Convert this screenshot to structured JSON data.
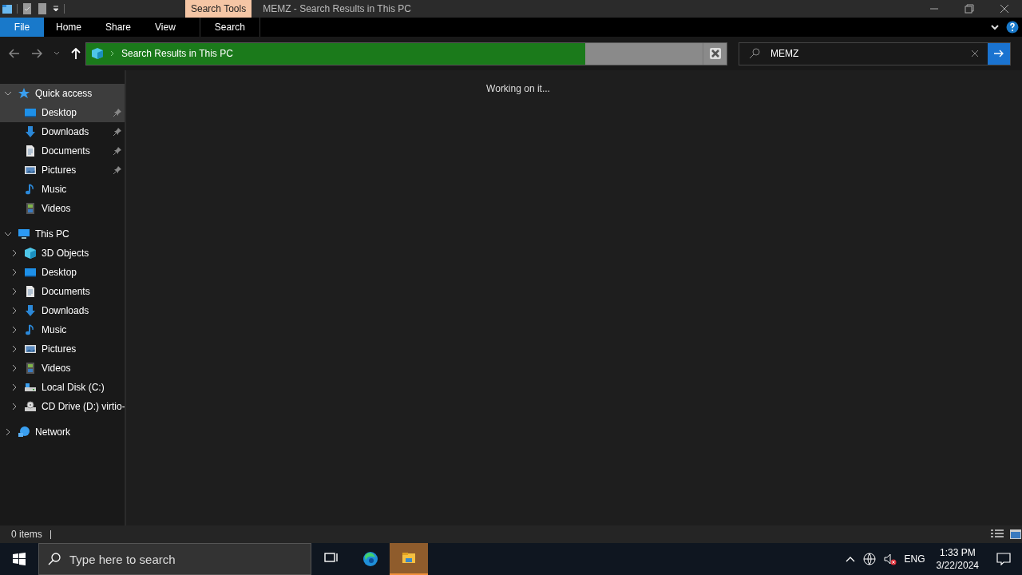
{
  "window": {
    "title": "MEMZ - Search Results in This PC",
    "context_tab": "Search Tools"
  },
  "ribbon_tabs": [
    {
      "label": "File",
      "kind": "file",
      "selected": false
    },
    {
      "label": "Home",
      "kind": "tab",
      "selected": false
    },
    {
      "label": "Share",
      "kind": "tab",
      "selected": false
    },
    {
      "label": "View",
      "kind": "tab",
      "selected": false
    },
    {
      "label": "Search",
      "kind": "context",
      "selected": false
    }
  ],
  "address_bar": {
    "path": "Search Results in This PC",
    "level": 0.81
  },
  "search": {
    "value": "MEMZ"
  },
  "sidebar": {
    "groups": [
      {
        "label": "Quick access",
        "kind": "star",
        "expanded": true,
        "selected": true,
        "children": [
          {
            "label": "Desktop",
            "kind": "desktop",
            "pinned": true,
            "selected": true
          },
          {
            "label": "Downloads",
            "kind": "download",
            "pinned": true,
            "selected": false
          },
          {
            "label": "Documents",
            "kind": "document",
            "pinned": true,
            "selected": false
          },
          {
            "label": "Pictures",
            "kind": "pictures",
            "pinned": true,
            "selected": false
          },
          {
            "label": "Music",
            "kind": "music",
            "pinned": false,
            "selected": false
          },
          {
            "label": "Videos",
            "kind": "videos",
            "pinned": false,
            "selected": false
          }
        ]
      },
      {
        "label": "This PC",
        "kind": "pc",
        "expanded": true,
        "selected": false,
        "children": [
          {
            "label": "3D Objects",
            "kind": "cube",
            "expanded": false,
            "selected": false
          },
          {
            "label": "Desktop",
            "kind": "desktop",
            "expanded": false,
            "selected": false
          },
          {
            "label": "Documents",
            "kind": "document",
            "expanded": false,
            "selected": false
          },
          {
            "label": "Downloads",
            "kind": "download",
            "expanded": false,
            "selected": false
          },
          {
            "label": "Music",
            "kind": "music",
            "expanded": false,
            "selected": false
          },
          {
            "label": "Pictures",
            "kind": "pictures",
            "expanded": false,
            "selected": false
          },
          {
            "label": "Videos",
            "kind": "videos",
            "expanded": false,
            "selected": false
          },
          {
            "label": "Local Disk (C:)",
            "kind": "disk",
            "expanded": false,
            "selected": false
          },
          {
            "label": "CD Drive (D:) virtio-",
            "kind": "cd",
            "expanded": false,
            "selected": false
          }
        ]
      },
      {
        "label": "Network",
        "kind": "network",
        "expanded": false,
        "selected": false
      }
    ]
  },
  "content": {
    "message": "Working on it..."
  },
  "status_bar": {
    "item_count": "0 items"
  },
  "taskbar": {
    "search_placeholder": "Type here to search",
    "apps": [
      {
        "kind": "taskview",
        "active": false
      },
      {
        "kind": "edge",
        "active": false
      },
      {
        "kind": "explorer",
        "active": true
      }
    ],
    "language": "ENG",
    "time": "1:33 PM",
    "date": "3/22/2024"
  }
}
